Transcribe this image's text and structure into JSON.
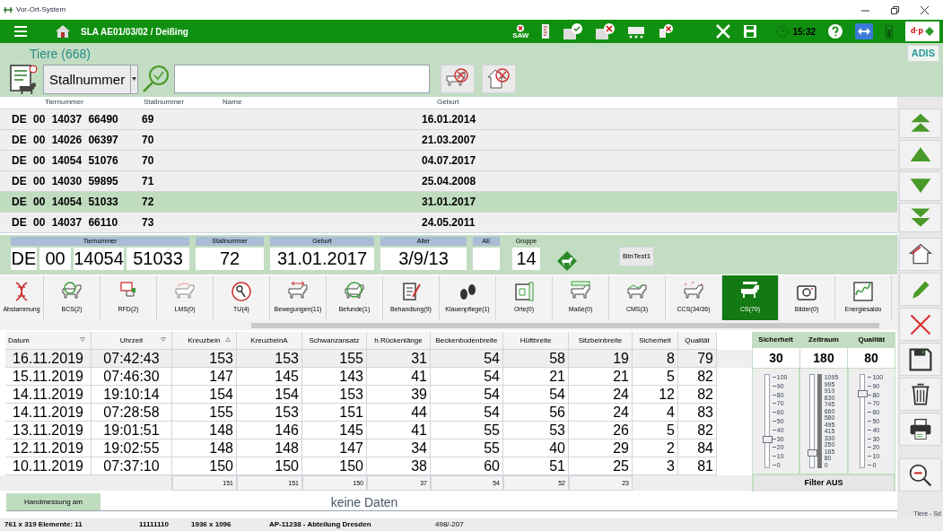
{
  "window": {
    "title": "Vor-Ort-System"
  },
  "header": {
    "location": "SLA AE01/03/02 / Deißing",
    "saw_label": "SAW",
    "time": "15:32",
    "logo": "d·p",
    "brand": "ADIS"
  },
  "search": {
    "title": "Tiere (668)",
    "field_selector": "Stallnummer"
  },
  "animal_list": {
    "columns": [
      "Tiernummer",
      "Stallnummer",
      "Name",
      "Geburt"
    ],
    "rows": [
      {
        "tiernummer": "DE 00 14037 66490",
        "stallnummer": "69",
        "geburt": "16.01.2014",
        "selected": false
      },
      {
        "tiernummer": "DE 00 14026 06397",
        "stallnummer": "70",
        "geburt": "21.03.2007",
        "selected": false
      },
      {
        "tiernummer": "DE 00 14054 51076",
        "stallnummer": "70",
        "geburt": "04.07.2017",
        "selected": false
      },
      {
        "tiernummer": "DE 00 14030 59895",
        "stallnummer": "71",
        "geburt": "25.04.2008",
        "selected": false
      },
      {
        "tiernummer": "DE 00 14054 51033",
        "stallnummer": "72",
        "geburt": "31.01.2017",
        "selected": true
      },
      {
        "tiernummer": "DE 00 14037 66110",
        "stallnummer": "73",
        "geburt": "24.05.2011",
        "selected": false
      }
    ]
  },
  "details": {
    "fields": [
      {
        "label": "Tiernummer",
        "parts": [
          "DE",
          "00",
          "14054",
          "51033"
        ]
      },
      {
        "label": "Stallnummer",
        "parts": [
          "72"
        ]
      },
      {
        "label": "Geburt",
        "parts": [
          "31.01.2017"
        ]
      },
      {
        "label": "Alter",
        "parts": [
          "3/9/13"
        ]
      },
      {
        "label": "AE"
      },
      {
        "label": "Gruppe",
        "parts": [
          "14"
        ]
      }
    ],
    "button": "BtnTest1"
  },
  "tabs": [
    {
      "label": "Abstammung",
      "selected": false
    },
    {
      "label": "BCS(2)",
      "selected": false
    },
    {
      "label": "RFD(2)",
      "selected": false
    },
    {
      "label": "LMS(0)",
      "selected": false
    },
    {
      "label": "TU(4)",
      "selected": false
    },
    {
      "label": "Bewegungen(11)",
      "selected": false
    },
    {
      "label": "Befunde(1)",
      "selected": false
    },
    {
      "label": "Behandlung(9)",
      "selected": false
    },
    {
      "label": "Klauenpflege(1)",
      "selected": false
    },
    {
      "label": "Orte(0)",
      "selected": false
    },
    {
      "label": "Maße(0)",
      "selected": false
    },
    {
      "label": "CMS(3)",
      "selected": false
    },
    {
      "label": "CCS(34/36)",
      "selected": false
    },
    {
      "label": "CS(70)",
      "selected": true
    },
    {
      "label": "Bilder(0)",
      "selected": false
    },
    {
      "label": "Energiesaldo",
      "selected": false
    }
  ],
  "measurements": {
    "columns": [
      {
        "label": "Datum",
        "sorted": true,
        "descending": true
      },
      {
        "label": "Uhrzeit",
        "sorted": true,
        "descending": true
      },
      {
        "label": "Kreuzbein",
        "sorted": true,
        "descending": false
      },
      {
        "label": "KreuzbeinA",
        "sorted": false
      },
      {
        "label": "Schwanzansatz",
        "sorted": false
      },
      {
        "label": "h.Rückenlänge",
        "sorted": false
      },
      {
        "label": "Beckenbodenbreite",
        "sorted": false
      },
      {
        "label": "Hüftbreite",
        "sorted": false
      },
      {
        "label": "Sitzbeinbreite",
        "sorted": false
      },
      {
        "label": "Sicherheit",
        "sorted": false
      },
      {
        "label": "Qualität",
        "sorted": false
      }
    ],
    "rows": [
      {
        "cells": [
          "16.11.2019",
          "07:42:43",
          "153",
          "153",
          "155",
          "31",
          "54",
          "58",
          "19",
          "8",
          "79"
        ],
        "selected": true
      },
      {
        "cells": [
          "15.11.2019",
          "07:46:30",
          "147",
          "145",
          "143",
          "41",
          "54",
          "21",
          "21",
          "5",
          "82"
        ],
        "selected": false
      },
      {
        "cells": [
          "14.11.2019",
          "19:10:14",
          "154",
          "154",
          "153",
          "39",
          "54",
          "54",
          "24",
          "12",
          "82"
        ],
        "selected": false
      },
      {
        "cells": [
          "14.11.2019",
          "07:28:58",
          "155",
          "153",
          "151",
          "44",
          "54",
          "56",
          "24",
          "4",
          "83"
        ],
        "selected": false
      },
      {
        "cells": [
          "13.11.2019",
          "19:01:51",
          "148",
          "146",
          "145",
          "41",
          "55",
          "53",
          "26",
          "5",
          "82"
        ],
        "selected": false
      },
      {
        "cells": [
          "12.11.2019",
          "19:02:55",
          "148",
          "148",
          "147",
          "34",
          "55",
          "40",
          "29",
          "2",
          "84"
        ],
        "selected": false
      },
      {
        "cells": [
          "10.11.2019",
          "07:37:10",
          "150",
          "150",
          "150",
          "38",
          "60",
          "51",
          "25",
          "3",
          "81"
        ],
        "selected": false
      }
    ],
    "totals": [
      "151",
      "151",
      "150",
      "37",
      "54",
      "52",
      "23"
    ]
  },
  "handmessung": {
    "label": "Handmessung am",
    "value": "keine Daten"
  },
  "filter": {
    "sliders": [
      {
        "label": "Sicherheit",
        "reading": "30",
        "level": 0.3,
        "ticks": [
          "100",
          "90",
          "80",
          "70",
          "60",
          "50",
          "40",
          "30",
          "20",
          "10",
          "0"
        ]
      },
      {
        "label": "Zeitraum",
        "reading": "180",
        "level": 0.16,
        "ticks": [
          "1095",
          "995",
          "910",
          "830",
          "745",
          "660",
          "580",
          "495",
          "415",
          "330",
          "250",
          "165",
          "80",
          "0"
        ]
      },
      {
        "label": "Qualität",
        "reading": "80",
        "level": 0.8,
        "ticks": [
          "100",
          "90",
          "80",
          "70",
          "60",
          "50",
          "40",
          "30",
          "20",
          "10",
          "0"
        ]
      }
    ],
    "button": "Filter AUS"
  },
  "status_bar": {
    "items": [
      "761 x 319 Elemente: 11",
      "11111110",
      "1936 x 1096",
      "AP-11238 - Abteilung Dresden",
      "498/-207"
    ],
    "right_label": "Tiere - Sd"
  }
}
